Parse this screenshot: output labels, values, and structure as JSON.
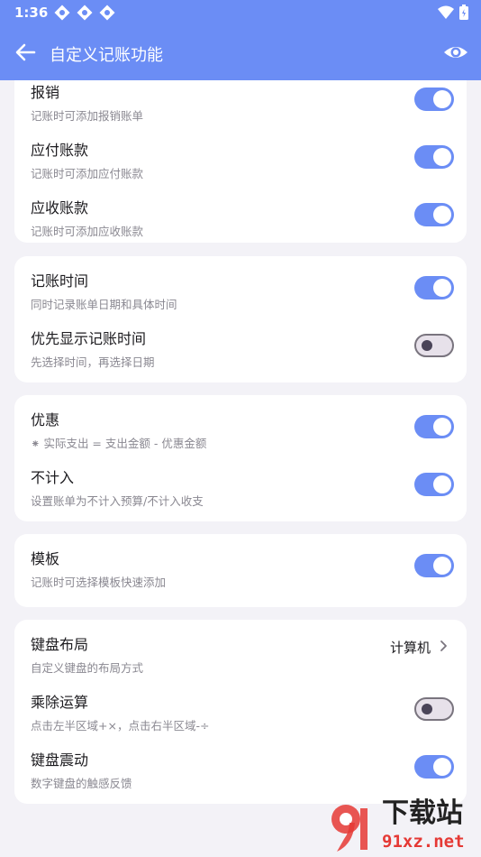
{
  "status": {
    "time": "1:36"
  },
  "appbar": {
    "title": "自定义记账功能"
  },
  "cards": [
    {
      "rows": [
        {
          "title": "报销",
          "sub": "记账时可添加报销账单",
          "on": true
        },
        {
          "title": "应付账款",
          "sub": "记账时可添加应付账款",
          "on": true
        },
        {
          "title": "应收账款",
          "sub": "记账时可添加应收账款",
          "on": true
        }
      ]
    },
    {
      "rows": [
        {
          "title": "记账时间",
          "sub": "同时记录账单日期和具体时间",
          "on": true
        },
        {
          "title": "优先显示记账时间",
          "sub": "先选择时间，再选择日期",
          "on": false
        }
      ]
    },
    {
      "rows": [
        {
          "title": "优惠",
          "sub": "⁕ 实际支出 = 支出金额 - 优惠金额",
          "on": true
        },
        {
          "title": "不计入",
          "sub": "设置账单为不计入预算/不计入收支",
          "on": true
        }
      ]
    },
    {
      "rows": [
        {
          "title": "模板",
          "sub": "记账时可选择模板快速添加",
          "on": true
        }
      ]
    },
    {
      "rows": [
        {
          "title": "键盘布局",
          "sub": "自定义键盘的布局方式",
          "value": "计算机"
        },
        {
          "title": "乘除运算",
          "sub": "点击左半区域+×，点击右半区域-÷",
          "on": false
        },
        {
          "title": "键盘震动",
          "sub": "数字键盘的触感反馈",
          "on": true
        }
      ]
    }
  ],
  "watermark": {
    "brand": "下载站",
    "url": "91xz.net"
  },
  "colors": {
    "accent": "#6b8df5",
    "background": "#f3f2f7",
    "card": "#ffffff"
  }
}
